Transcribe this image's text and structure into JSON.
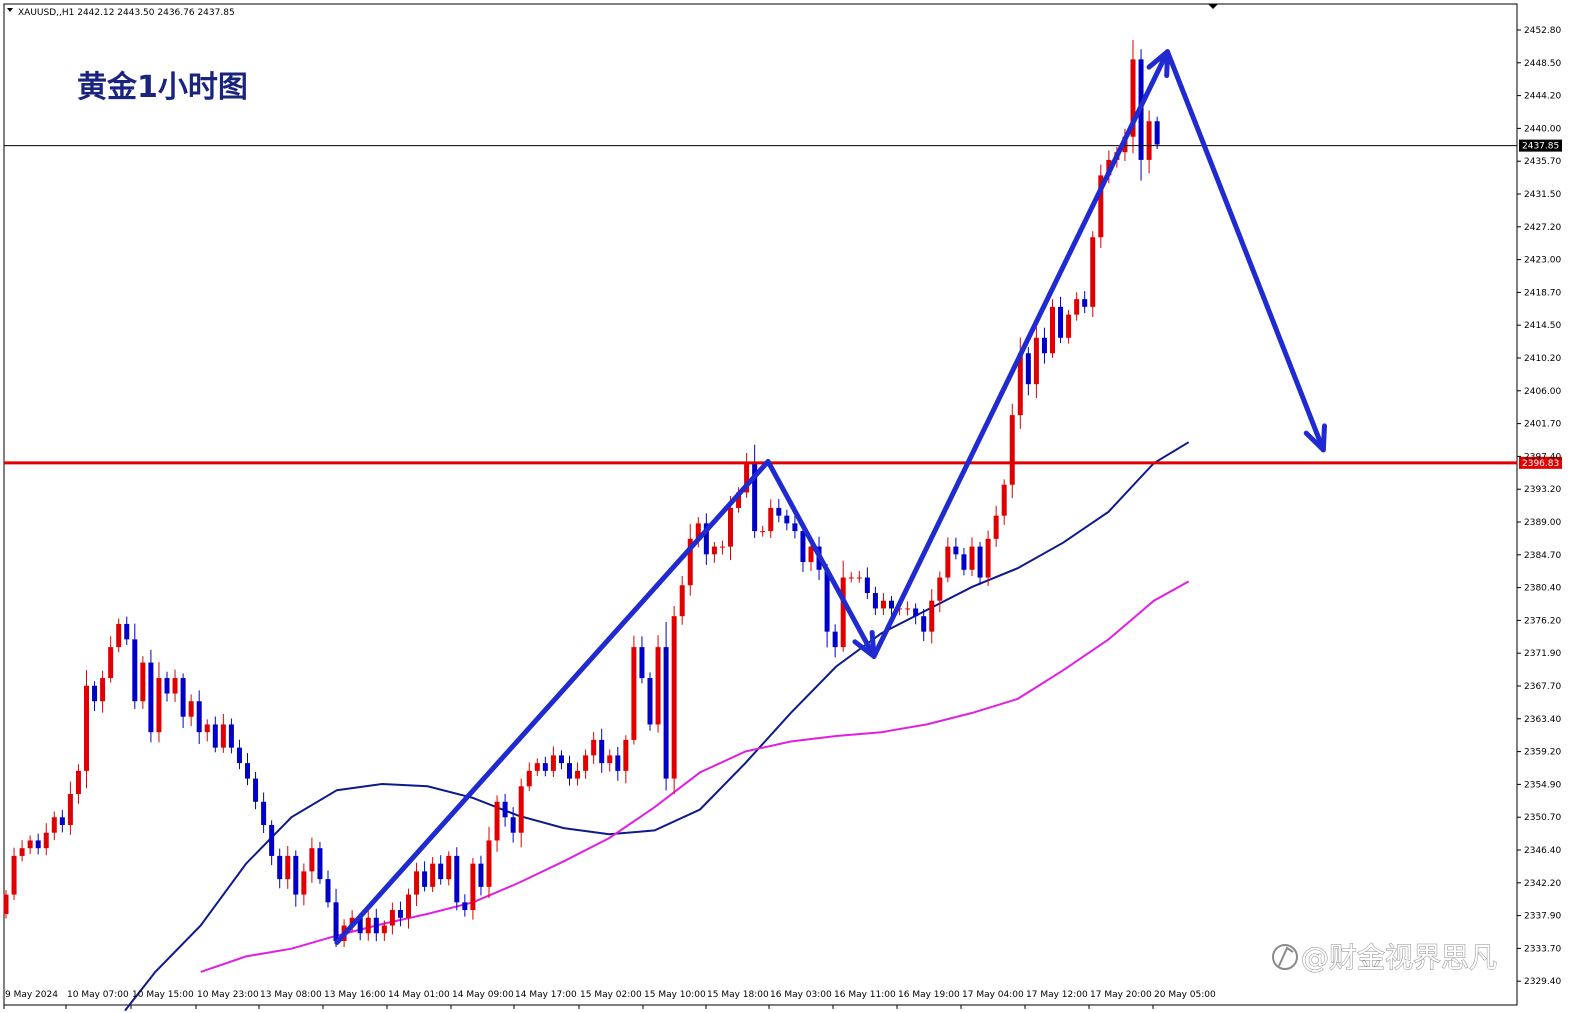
{
  "header": {
    "symbol_info": "XAUUSD,,H1  2442.12 2443.50 2436.76 2437.85"
  },
  "title": "黄金1小时图",
  "watermark": "@财金视界思凡",
  "colors": {
    "bull": "#e00000",
    "bear": "#0000c8",
    "ma_fast": "#0d1a8c",
    "ma_slow": "#e020e0",
    "arrow": "#1f2ad0",
    "resistance": "#e00000",
    "current": "#000000"
  },
  "chart_data": {
    "type": "candlestick",
    "symbol": "XAUUSD",
    "timeframe": "H1",
    "ylim": [
      2329.4,
      2455.0
    ],
    "y_ticks": [
      "2452.80",
      "2448.50",
      "2444.20",
      "2440.00",
      "2435.70",
      "2431.50",
      "2427.20",
      "2423.00",
      "2418.70",
      "2414.50",
      "2410.20",
      "2406.00",
      "2401.70",
      "2397.40",
      "2393.20",
      "2389.00",
      "2384.70",
      "2380.40",
      "2376.20",
      "2371.90",
      "2367.70",
      "2363.40",
      "2359.20",
      "2354.90",
      "2350.70",
      "2346.40",
      "2342.20",
      "2337.90",
      "2333.70",
      "2329.40"
    ],
    "x_labels": [
      "9 May 2024",
      "10 May 07:00",
      "10 May 15:00",
      "10 May 23:00",
      "13 May 08:00",
      "13 May 16:00",
      "14 May 01:00",
      "14 May 09:00",
      "14 May 17:00",
      "15 May 02:00",
      "15 May 10:00",
      "15 May 18:00",
      "16 May 03:00",
      "16 May 11:00",
      "16 May 19:00",
      "17 May 04:00",
      "17 May 12:00",
      "17 May 20:00",
      "20 May 05:00"
    ],
    "current_price": {
      "label": "2437.85",
      "value": 2437.85
    },
    "resistance": {
      "label": "2396.83",
      "value": 2396.83
    },
    "closes": [
      2341,
      2346,
      2347,
      2348,
      2347,
      2349,
      2351,
      2350,
      2354,
      2357,
      2368,
      2366,
      2369,
      2373,
      2376,
      2374,
      2366,
      2371,
      2362,
      2369,
      2367,
      2369,
      2364,
      2366,
      2362,
      2363,
      2360,
      2363,
      2360,
      2358,
      2356,
      2353,
      2350,
      2346,
      2343,
      2346,
      2341,
      2344,
      2347,
      2343,
      2340,
      2335,
      2337,
      2338,
      2336,
      2338,
      2336,
      2337,
      2339,
      2338,
      2341,
      2344,
      2342,
      2345,
      2343,
      2346,
      2340,
      2339,
      2345,
      2342,
      2348,
      2353,
      2351,
      2349,
      2355,
      2357,
      2358,
      2357,
      2359,
      2358,
      2356,
      2357,
      2359,
      2361,
      2358,
      2359,
      2357,
      2361,
      2373,
      2369,
      2363,
      2373,
      2356,
      2377,
      2381,
      2387,
      2389,
      2385,
      2386,
      2386,
      2391,
      2393,
      2397,
      2388,
      2388,
      2391,
      2390,
      2389,
      2388,
      2384,
      2386,
      2383,
      2375,
      2373,
      2382,
      2382,
      2382,
      2380,
      2378,
      2379,
      2378,
      2378,
      2378,
      2377,
      2375,
      2379,
      2382,
      2386,
      2385,
      2383,
      2386,
      2382,
      2387,
      2390,
      2394,
      2403,
      2411,
      2407,
      2413,
      2411,
      2417,
      2413,
      2416,
      2418,
      2417,
      2426,
      2434,
      2436,
      2437,
      2439,
      2449,
      2436,
      2441,
      2438
    ],
    "ma_fast": [
      [
        0.08,
        2326
      ],
      [
        0.1,
        2331
      ],
      [
        0.13,
        2337
      ],
      [
        0.16,
        2345
      ],
      [
        0.19,
        2351
      ],
      [
        0.22,
        2354.5
      ],
      [
        0.25,
        2355.3
      ],
      [
        0.28,
        2355.0
      ],
      [
        0.31,
        2353.5
      ],
      [
        0.34,
        2351.2
      ],
      [
        0.37,
        2349.6
      ],
      [
        0.4,
        2348.8
      ],
      [
        0.43,
        2349.3
      ],
      [
        0.46,
        2352.0
      ],
      [
        0.49,
        2358
      ],
      [
        0.52,
        2364.5
      ],
      [
        0.55,
        2370.5
      ],
      [
        0.58,
        2374.8
      ],
      [
        0.61,
        2377.8
      ],
      [
        0.64,
        2380.8
      ],
      [
        0.67,
        2383.2
      ],
      [
        0.7,
        2386.5
      ],
      [
        0.73,
        2390.5
      ],
      [
        0.76,
        2396.8
      ],
      [
        0.783,
        2399.5
      ]
    ],
    "ma_slow": [
      [
        0.13,
        2331
      ],
      [
        0.16,
        2333
      ],
      [
        0.19,
        2334
      ],
      [
        0.22,
        2335.7
      ],
      [
        0.25,
        2337.2
      ],
      [
        0.28,
        2338.5
      ],
      [
        0.31,
        2340.0
      ],
      [
        0.34,
        2342.5
      ],
      [
        0.37,
        2345.3
      ],
      [
        0.4,
        2348.3
      ],
      [
        0.43,
        2352.3
      ],
      [
        0.46,
        2356.8
      ],
      [
        0.49,
        2359.5
      ],
      [
        0.52,
        2360.8
      ],
      [
        0.55,
        2361.5
      ],
      [
        0.58,
        2362.0
      ],
      [
        0.61,
        2363.0
      ],
      [
        0.64,
        2364.5
      ],
      [
        0.67,
        2366.3
      ],
      [
        0.7,
        2370.0
      ],
      [
        0.73,
        2374.0
      ],
      [
        0.76,
        2379.0
      ],
      [
        0.783,
        2381.5
      ]
    ],
    "annotations": {
      "arrows": [
        {
          "from": [
            0.22,
            2334.8
          ],
          "to": [
            0.505,
            2397.0
          ],
          "head": false
        },
        {
          "from": [
            0.505,
            2397.0
          ],
          "to": [
            0.575,
            2371.8
          ],
          "head": true
        },
        {
          "from": [
            0.575,
            2371.8
          ],
          "to": [
            0.769,
            2450.0
          ],
          "head": true
        },
        {
          "from": [
            0.769,
            2450.0
          ],
          "to": [
            0.872,
            2398.5
          ],
          "head": true
        }
      ]
    }
  }
}
